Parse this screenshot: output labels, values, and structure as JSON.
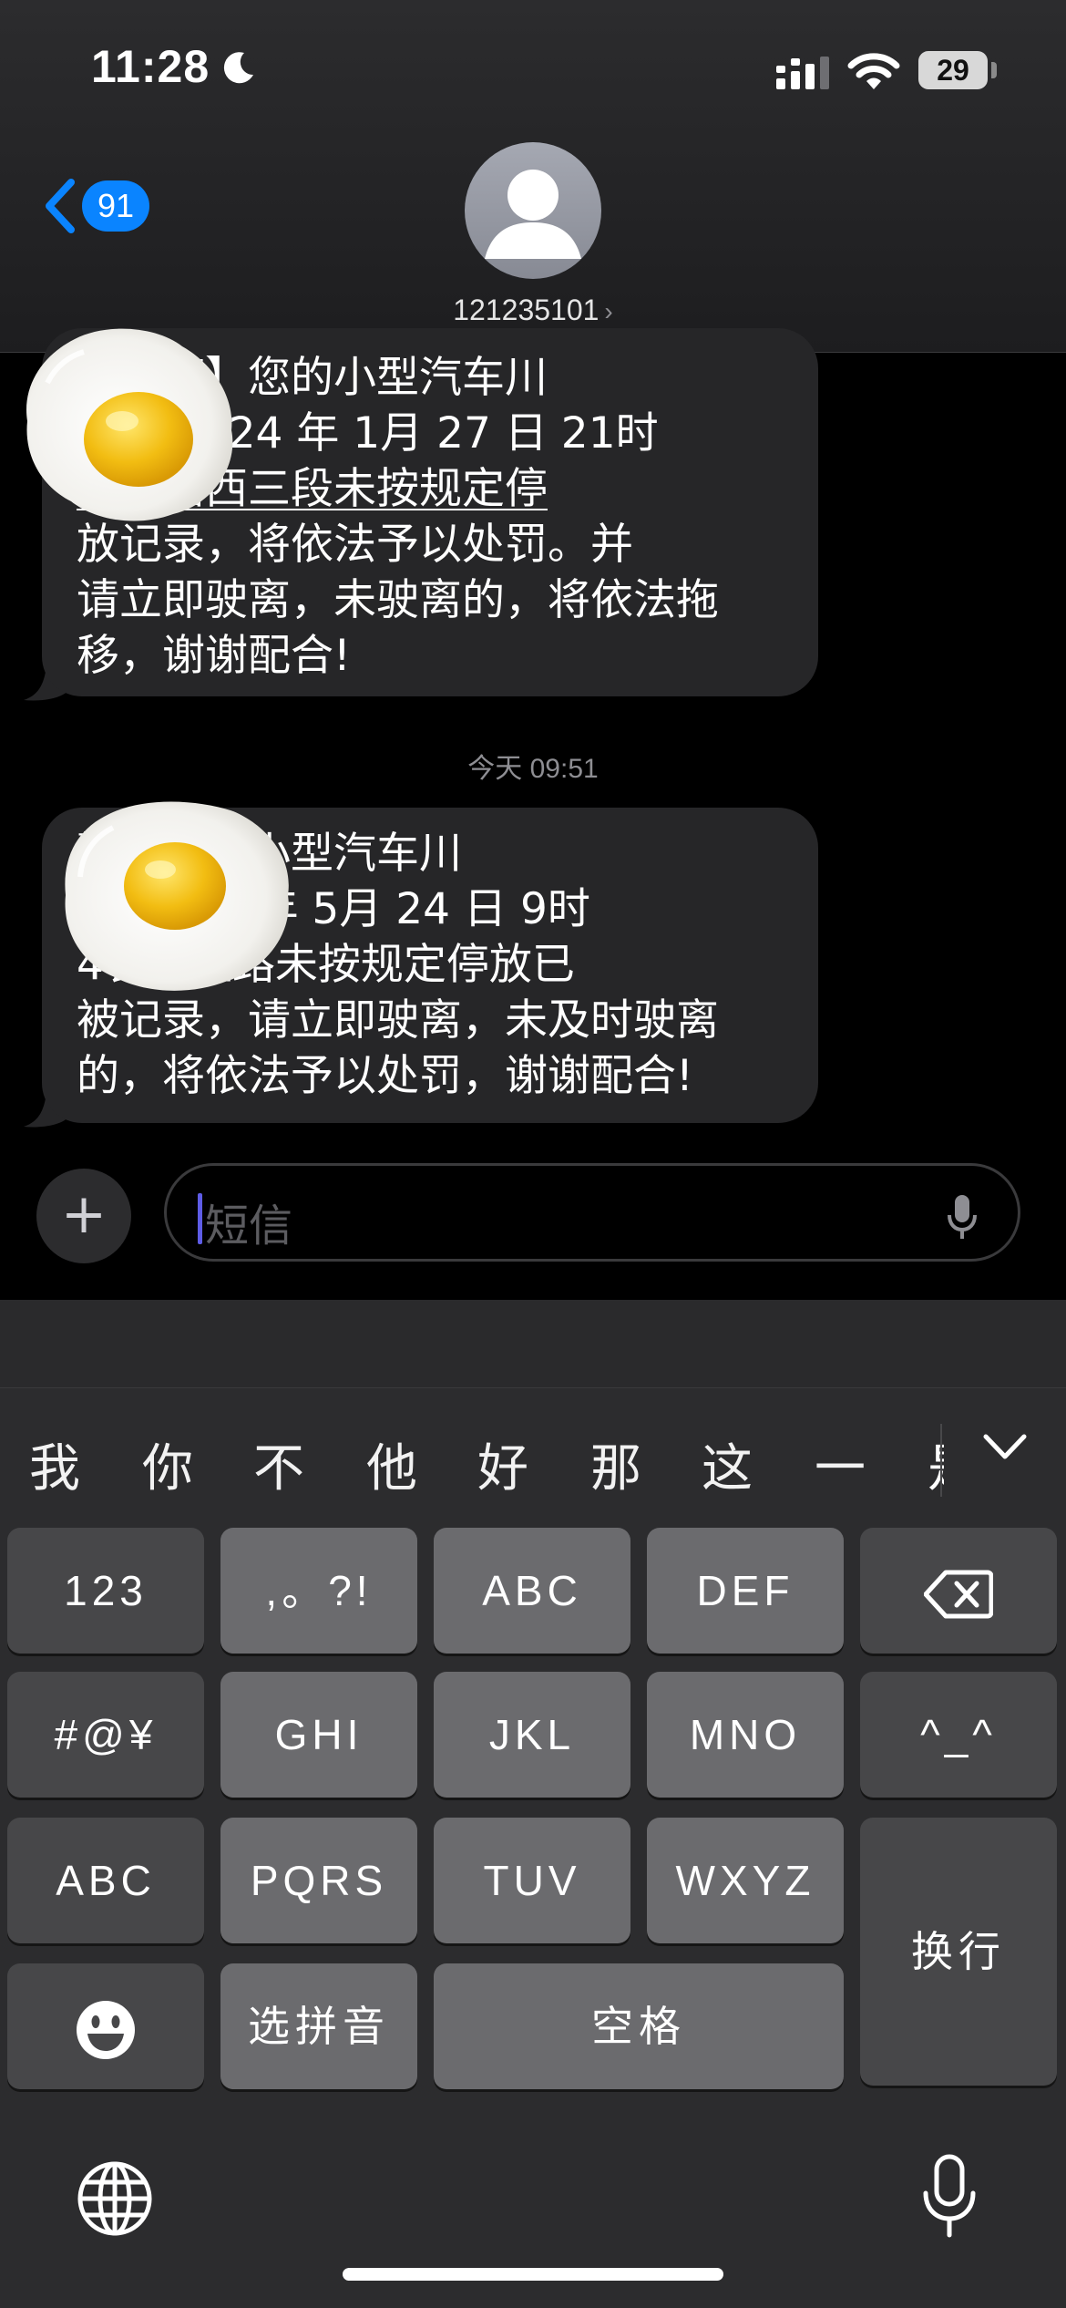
{
  "status_bar": {
    "time": "11:28",
    "battery": "29"
  },
  "header": {
    "back_badge": "91",
    "contact": "121235101",
    "contact_chevron": "›"
  },
  "messages": [
    {
      "lines": [
        "【交警】您的小型汽车川",
        "7 于 2024 年 1月 27 日 21时",
        "一环路西三段未按规定停",
        "放记录，将依法予以处罚。并",
        "请立即驶离，未驶离的，将依法拖",
        "移，谢谢配合!"
      ]
    },
    {
      "lines": [
        "警】您的小型汽车川",
        "于 2024 年 5月 24 日 9时",
        "4长林盘路未按规定停放已",
        "被记录，请立即驶离，未及时驶离",
        "的，将依法予以处罚，谢谢配合!"
      ]
    }
  ],
  "timestamp": "今天 09:51",
  "compose": {
    "plus": "+",
    "placeholder": "短信"
  },
  "keyboard": {
    "candidates": [
      "我",
      "你",
      "不",
      "他",
      "好",
      "那",
      "这",
      "一"
    ],
    "candidate_clipped": "是",
    "keys": {
      "k123": "123",
      "punct": ",。?!",
      "abc": "ABC",
      "def": "DEF",
      "symbols": "#@¥",
      "ghi": "GHI",
      "jkl": "JKL",
      "mno": "MNO",
      "emoticon": "^_^",
      "abc_switch": "ABC",
      "pqrs": "PQRS",
      "tuv": "TUV",
      "wxyz": "WXYZ",
      "return": "换行",
      "pinyin": "选拼音",
      "space": "空格"
    }
  }
}
